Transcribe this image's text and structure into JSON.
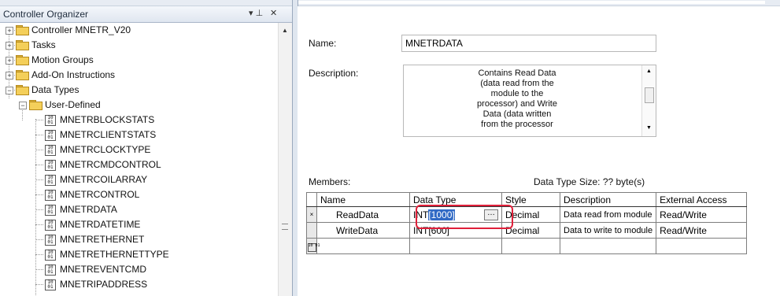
{
  "organizer": {
    "title": "Controller Organizer",
    "pin_glyph": "▾ ⊥",
    "close_glyph": "✕",
    "items": [
      {
        "label": "Controller MNETR_V20"
      },
      {
        "label": "Tasks"
      },
      {
        "label": "Motion Groups"
      },
      {
        "label": "Add-On Instructions"
      },
      {
        "label": "Data Types"
      },
      {
        "label": "User-Defined"
      },
      {
        "label": "MNETRBLOCKSTATS"
      },
      {
        "label": "MNETRCLIENTSTATS"
      },
      {
        "label": "MNETRCLOCKTYPE"
      },
      {
        "label": "MNETRCMDCONTROL"
      },
      {
        "label": "MNETRCOILARRAY"
      },
      {
        "label": "MNETRCONTROL"
      },
      {
        "label": "MNETRDATA"
      },
      {
        "label": "MNETRDATETIME"
      },
      {
        "label": "MNETRETHERNET"
      },
      {
        "label": "MNETRETHERNETTYPE"
      },
      {
        "label": "MNETREVENTCMD"
      },
      {
        "label": "MNETRIPADDRESS"
      }
    ]
  },
  "form": {
    "name_label": "Name:",
    "name_value": "MNETRDATA",
    "description_label": "Description:",
    "description_value": "Contains Read Data\n(data read from the\nmodule to the\nprocessor) and Write\nData (data written\nfrom the processor",
    "members_label": "Members:",
    "data_type_size": "Data Type Size: ?? byte(s)"
  },
  "members_table": {
    "columns": [
      "Name",
      "Data Type",
      "Style",
      "Description",
      "External Access"
    ],
    "rows": [
      {
        "marker": "×",
        "name": "ReadData",
        "type_prefix": "INT",
        "type_selected": "[1000]",
        "ellipsis": "…",
        "style": "Decimal",
        "description": "Data read from module",
        "access": "Read/Write"
      },
      {
        "marker": "",
        "name": "WriteData",
        "type_prefix": "INT[600]",
        "type_selected": "",
        "ellipsis": "",
        "style": "Decimal",
        "description": "Data to write to module",
        "access": "Read/Write"
      },
      {
        "marker": "10 01",
        "name": "",
        "type_prefix": "",
        "type_selected": "",
        "ellipsis": "",
        "style": "",
        "description": "",
        "access": ""
      }
    ]
  },
  "colors": {
    "selection": "#316ac5",
    "highlight_ring": "#e0203a",
    "folder": "#f4cf5a"
  }
}
